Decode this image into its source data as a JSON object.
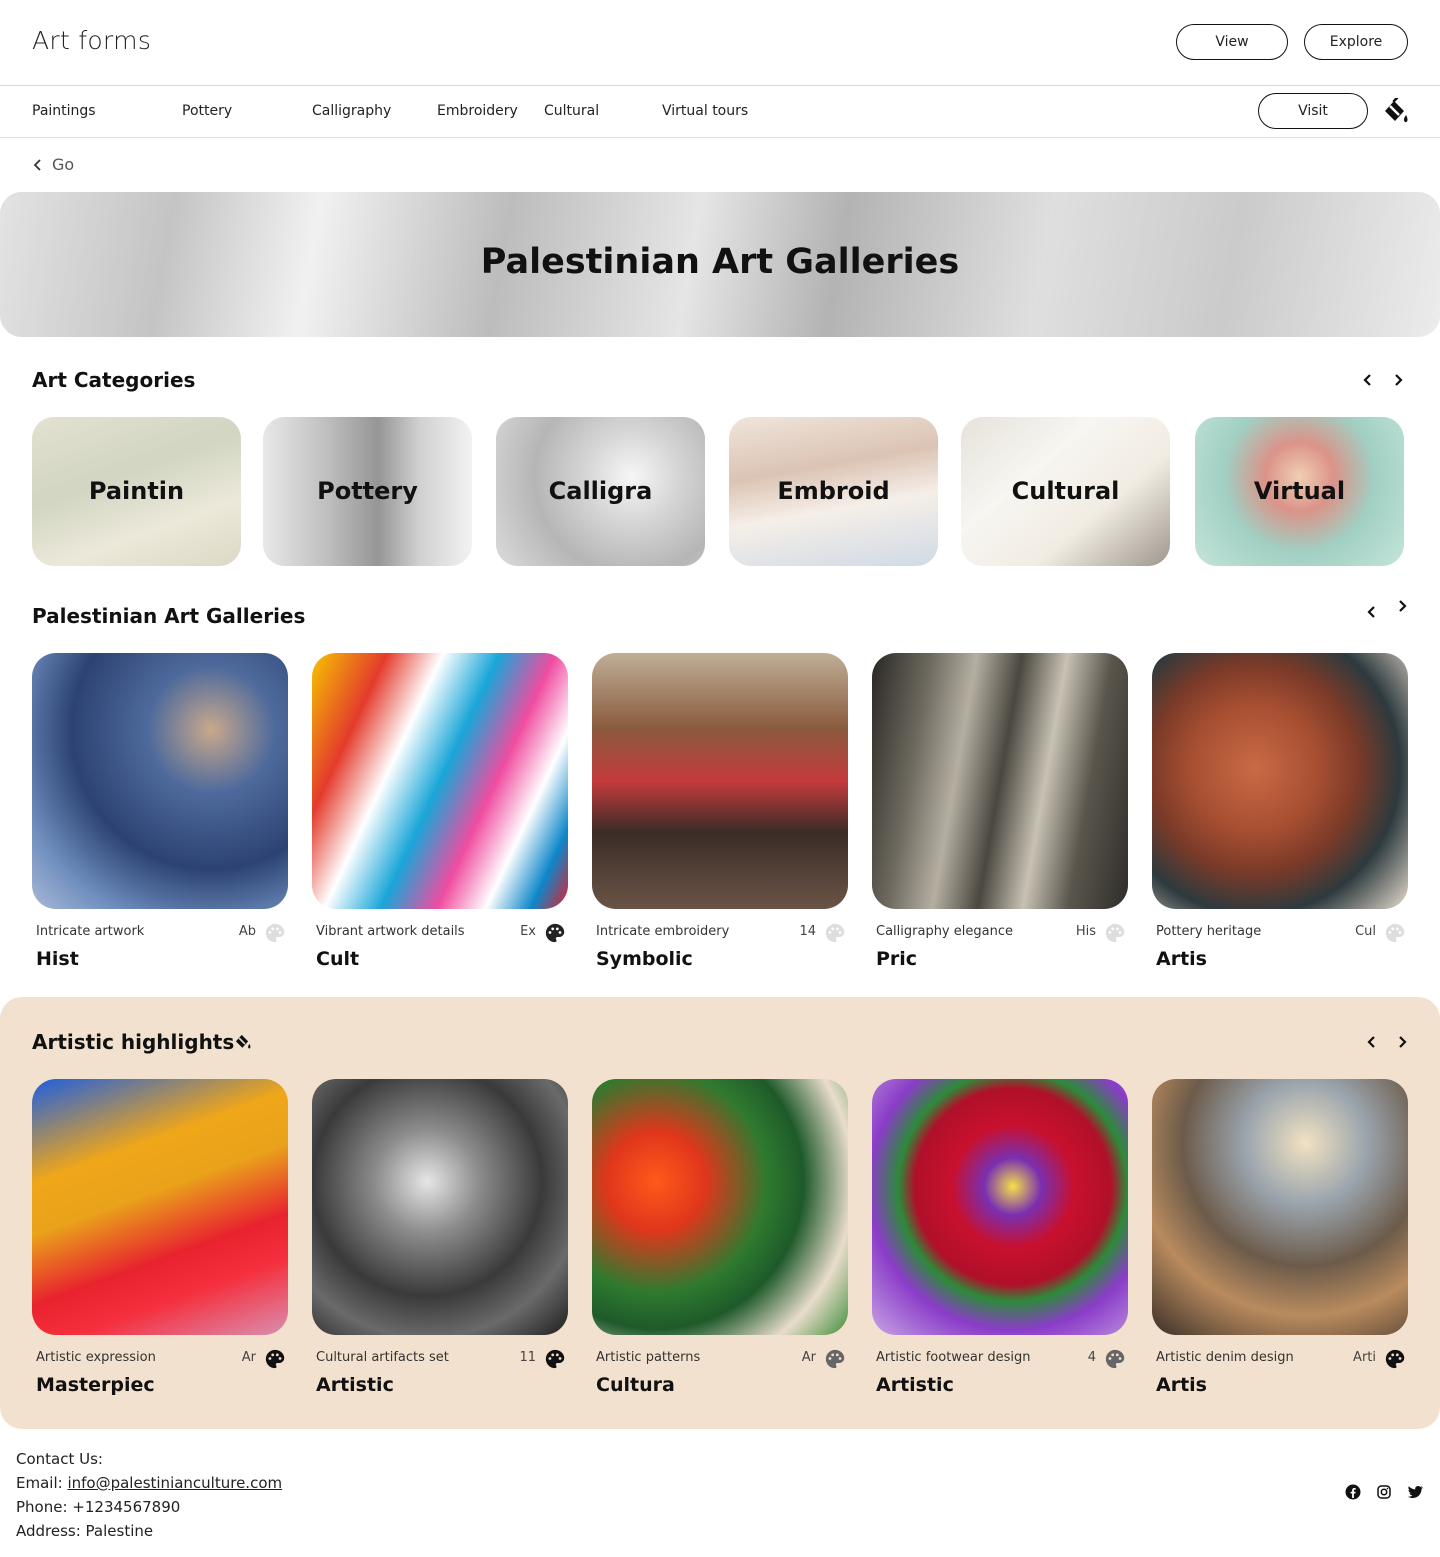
{
  "header": {
    "brand": "Art forms",
    "view_label": "View",
    "explore_label": "Explore"
  },
  "nav": {
    "items": [
      "Paintings",
      "Pottery",
      "Calligraphy",
      "Embroidery",
      "Cultural",
      "Virtual tours"
    ],
    "visit_label": "Visit"
  },
  "back_label": "Go",
  "hero": {
    "title": "Palestinian Art Galleries"
  },
  "categories": {
    "title": "Art Categories",
    "items": [
      "Paintin",
      "Pottery",
      "Calligra",
      "Embroid",
      "Cultural",
      "Virtual"
    ]
  },
  "galleries": {
    "title": "Palestinian Art Galleries",
    "items": [
      {
        "desc": "Intricate artwork",
        "tag": "Ab",
        "name": "Hist"
      },
      {
        "desc": "Vibrant artwork details",
        "tag": "Ex",
        "name": "Cult"
      },
      {
        "desc": "Intricate embroidery",
        "tag": "14",
        "name": "Symbolic"
      },
      {
        "desc": "Calligraphy elegance",
        "tag": "His",
        "name": "Pric"
      },
      {
        "desc": "Pottery heritage",
        "tag": "Cul",
        "name": "Artis"
      }
    ]
  },
  "highlights": {
    "title": "Artistic highlights",
    "items": [
      {
        "desc": "Artistic expression",
        "tag": "Ar",
        "name": "Masterpiec"
      },
      {
        "desc": "Cultural artifacts set",
        "tag": "11",
        "name": "Artistic"
      },
      {
        "desc": "Artistic patterns",
        "tag": "Ar",
        "name": "Cultura"
      },
      {
        "desc": "Artistic footwear design",
        "tag": "4",
        "name": "Artistic"
      },
      {
        "desc": "Artistic denim design",
        "tag": "Arti",
        "name": "Artis"
      }
    ]
  },
  "footer": {
    "contact_label": "Contact Us:",
    "email_label": "Email: ",
    "email": "info@palestinianculture.com",
    "phone": "Phone: +1234567890",
    "address": "Address: Palestine"
  },
  "colors": {
    "highlight_bg": "#f2e1ce",
    "text": "#111111",
    "border": "#d9d9d9"
  }
}
